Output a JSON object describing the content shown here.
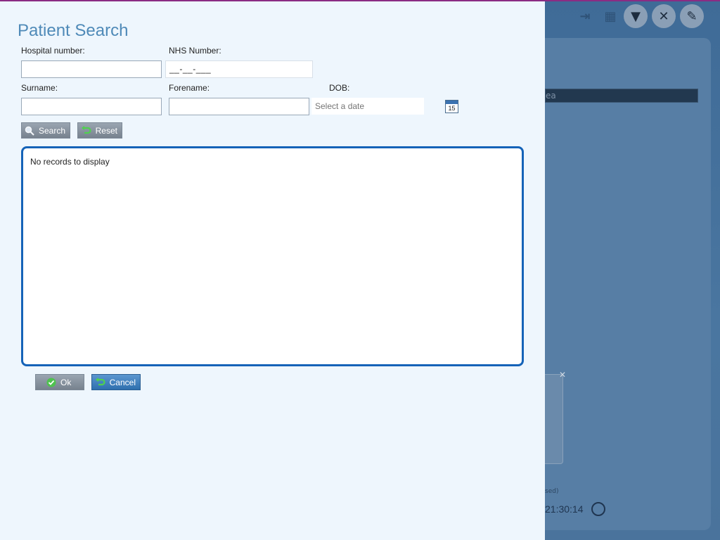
{
  "dialog": {
    "title": "Patient Search",
    "labels": {
      "hospital_number": "Hospital number:",
      "nhs_number": "NHS Number:",
      "surname": "Surname:",
      "forename": "Forename:",
      "dob": "DOB:"
    },
    "fields": {
      "hospital_number_value": "",
      "nhs_number_mask": "__-__-___",
      "surname_value": "",
      "forename_value": "",
      "dob_placeholder": "Select a date"
    },
    "calendar_day": "15",
    "buttons": {
      "search": "Search",
      "reset": "Reset",
      "ok": "Ok",
      "cancel": "Cancel"
    },
    "results_empty": "No records to display"
  },
  "background": {
    "search_strip_text": "ea",
    "card_text": "sed)",
    "time": "21:30:14"
  },
  "colors": {
    "title": "#4f8ab8",
    "results_border": "#1563b8",
    "dialog_bg": "#eef6fd",
    "top_line": "#8a2c83"
  }
}
